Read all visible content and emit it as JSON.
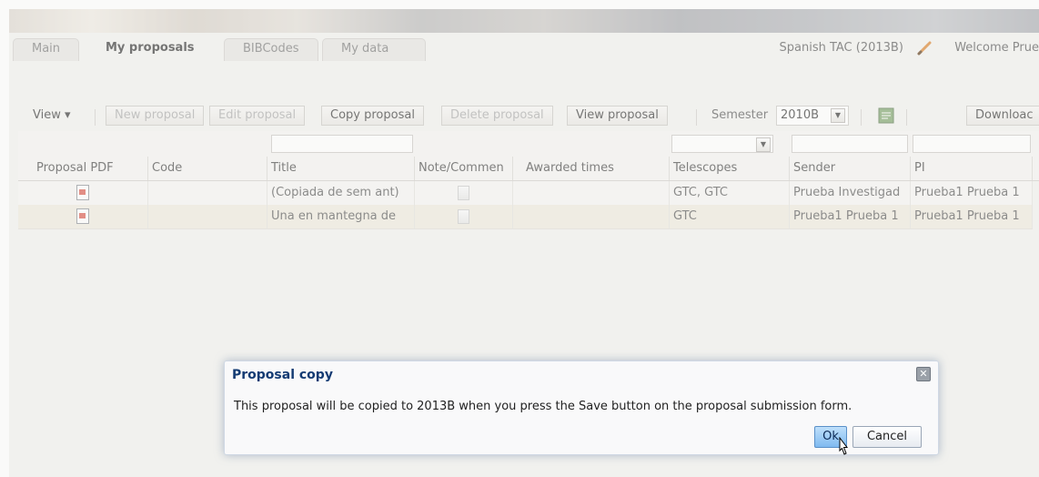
{
  "tabs": {
    "items": [
      "Main",
      "My proposals",
      "BIBCodes",
      "My data"
    ],
    "active": "My proposals"
  },
  "header": {
    "tac": "Spanish TAC  (2013B)",
    "welcome": "Welcome Prue"
  },
  "toolbar": {
    "view": "View ▾",
    "new_proposal": "New proposal",
    "edit_proposal": "Edit proposal",
    "copy_proposal": "Copy proposal",
    "delete_proposal": "Delete proposal",
    "view_proposal": "View proposal",
    "semester_label": "Semester",
    "semester_value": "2010B",
    "download": "Downloac"
  },
  "grid": {
    "columns": [
      "Proposal PDF",
      "Code",
      "Title",
      "Note/Commen",
      "Awarded times",
      "Telescopes",
      "Sender",
      "PI"
    ],
    "rows": [
      {
        "code": "",
        "title": "(Copiada de sem ant)",
        "awarded": "",
        "telescopes": "GTC, GTC",
        "sender": "Prueba Investigad",
        "pi": "Prueba1 Prueba 1"
      },
      {
        "code": "",
        "title": "Una en mantegna de",
        "awarded": "",
        "telescopes": "GTC",
        "sender": "Prueba1 Prueba 1",
        "pi": "Prueba1 Prueba 1"
      }
    ]
  },
  "dialog": {
    "title": "Proposal copy",
    "message": "This proposal will be copied to 2013B when you press the Save button on the proposal submission form.",
    "ok": "Ok",
    "cancel": "Cancel"
  },
  "colors": {
    "dialog_title": "#143b73",
    "ok_button": "#7fbaf0",
    "app_background": "#f1f1ef"
  }
}
